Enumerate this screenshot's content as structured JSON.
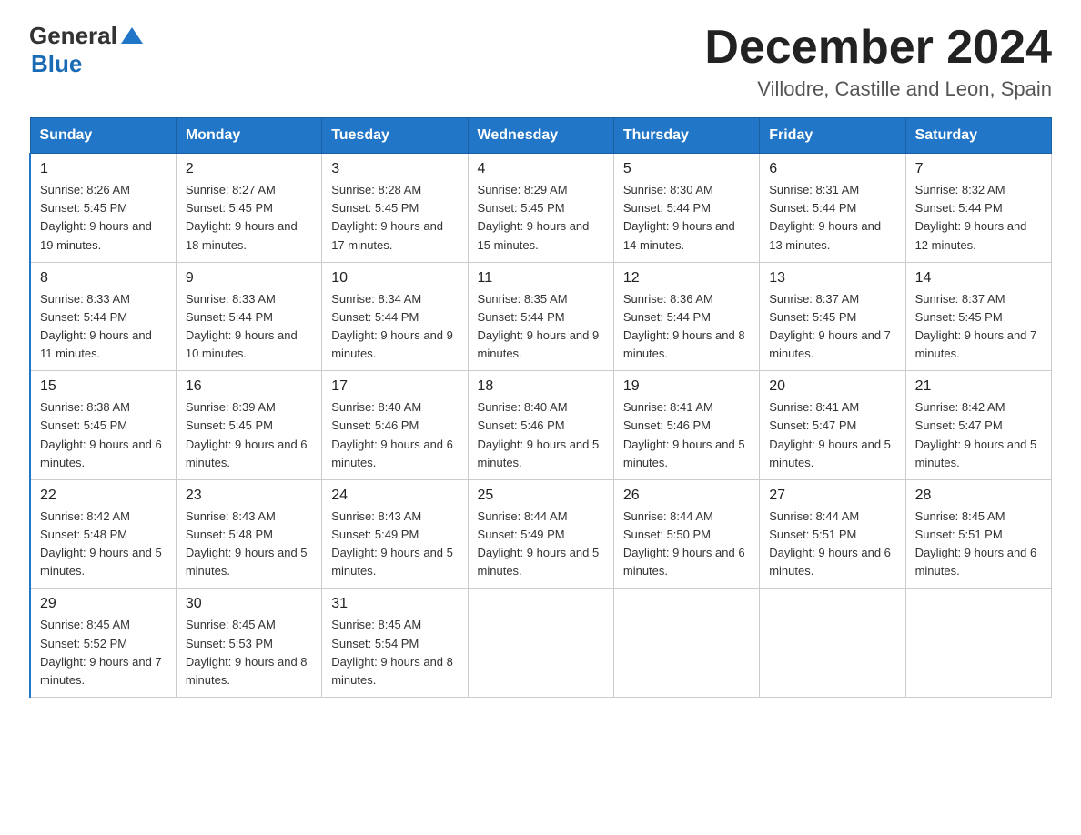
{
  "header": {
    "logo_general": "General",
    "logo_blue": "Blue",
    "month": "December 2024",
    "location": "Villodre, Castille and Leon, Spain"
  },
  "weekdays": [
    "Sunday",
    "Monday",
    "Tuesday",
    "Wednesday",
    "Thursday",
    "Friday",
    "Saturday"
  ],
  "weeks": [
    [
      {
        "day": "1",
        "sunrise": "8:26 AM",
        "sunset": "5:45 PM",
        "daylight": "9 hours and 19 minutes."
      },
      {
        "day": "2",
        "sunrise": "8:27 AM",
        "sunset": "5:45 PM",
        "daylight": "9 hours and 18 minutes."
      },
      {
        "day": "3",
        "sunrise": "8:28 AM",
        "sunset": "5:45 PM",
        "daylight": "9 hours and 17 minutes."
      },
      {
        "day": "4",
        "sunrise": "8:29 AM",
        "sunset": "5:45 PM",
        "daylight": "9 hours and 15 minutes."
      },
      {
        "day": "5",
        "sunrise": "8:30 AM",
        "sunset": "5:44 PM",
        "daylight": "9 hours and 14 minutes."
      },
      {
        "day": "6",
        "sunrise": "8:31 AM",
        "sunset": "5:44 PM",
        "daylight": "9 hours and 13 minutes."
      },
      {
        "day": "7",
        "sunrise": "8:32 AM",
        "sunset": "5:44 PM",
        "daylight": "9 hours and 12 minutes."
      }
    ],
    [
      {
        "day": "8",
        "sunrise": "8:33 AM",
        "sunset": "5:44 PM",
        "daylight": "9 hours and 11 minutes."
      },
      {
        "day": "9",
        "sunrise": "8:33 AM",
        "sunset": "5:44 PM",
        "daylight": "9 hours and 10 minutes."
      },
      {
        "day": "10",
        "sunrise": "8:34 AM",
        "sunset": "5:44 PM",
        "daylight": "9 hours and 9 minutes."
      },
      {
        "day": "11",
        "sunrise": "8:35 AM",
        "sunset": "5:44 PM",
        "daylight": "9 hours and 9 minutes."
      },
      {
        "day": "12",
        "sunrise": "8:36 AM",
        "sunset": "5:44 PM",
        "daylight": "9 hours and 8 minutes."
      },
      {
        "day": "13",
        "sunrise": "8:37 AM",
        "sunset": "5:45 PM",
        "daylight": "9 hours and 7 minutes."
      },
      {
        "day": "14",
        "sunrise": "8:37 AM",
        "sunset": "5:45 PM",
        "daylight": "9 hours and 7 minutes."
      }
    ],
    [
      {
        "day": "15",
        "sunrise": "8:38 AM",
        "sunset": "5:45 PM",
        "daylight": "9 hours and 6 minutes."
      },
      {
        "day": "16",
        "sunrise": "8:39 AM",
        "sunset": "5:45 PM",
        "daylight": "9 hours and 6 minutes."
      },
      {
        "day": "17",
        "sunrise": "8:40 AM",
        "sunset": "5:46 PM",
        "daylight": "9 hours and 6 minutes."
      },
      {
        "day": "18",
        "sunrise": "8:40 AM",
        "sunset": "5:46 PM",
        "daylight": "9 hours and 5 minutes."
      },
      {
        "day": "19",
        "sunrise": "8:41 AM",
        "sunset": "5:46 PM",
        "daylight": "9 hours and 5 minutes."
      },
      {
        "day": "20",
        "sunrise": "8:41 AM",
        "sunset": "5:47 PM",
        "daylight": "9 hours and 5 minutes."
      },
      {
        "day": "21",
        "sunrise": "8:42 AM",
        "sunset": "5:47 PM",
        "daylight": "9 hours and 5 minutes."
      }
    ],
    [
      {
        "day": "22",
        "sunrise": "8:42 AM",
        "sunset": "5:48 PM",
        "daylight": "9 hours and 5 minutes."
      },
      {
        "day": "23",
        "sunrise": "8:43 AM",
        "sunset": "5:48 PM",
        "daylight": "9 hours and 5 minutes."
      },
      {
        "day": "24",
        "sunrise": "8:43 AM",
        "sunset": "5:49 PM",
        "daylight": "9 hours and 5 minutes."
      },
      {
        "day": "25",
        "sunrise": "8:44 AM",
        "sunset": "5:49 PM",
        "daylight": "9 hours and 5 minutes."
      },
      {
        "day": "26",
        "sunrise": "8:44 AM",
        "sunset": "5:50 PM",
        "daylight": "9 hours and 6 minutes."
      },
      {
        "day": "27",
        "sunrise": "8:44 AM",
        "sunset": "5:51 PM",
        "daylight": "9 hours and 6 minutes."
      },
      {
        "day": "28",
        "sunrise": "8:45 AM",
        "sunset": "5:51 PM",
        "daylight": "9 hours and 6 minutes."
      }
    ],
    [
      {
        "day": "29",
        "sunrise": "8:45 AM",
        "sunset": "5:52 PM",
        "daylight": "9 hours and 7 minutes."
      },
      {
        "day": "30",
        "sunrise": "8:45 AM",
        "sunset": "5:53 PM",
        "daylight": "9 hours and 8 minutes."
      },
      {
        "day": "31",
        "sunrise": "8:45 AM",
        "sunset": "5:54 PM",
        "daylight": "9 hours and 8 minutes."
      },
      null,
      null,
      null,
      null
    ]
  ]
}
